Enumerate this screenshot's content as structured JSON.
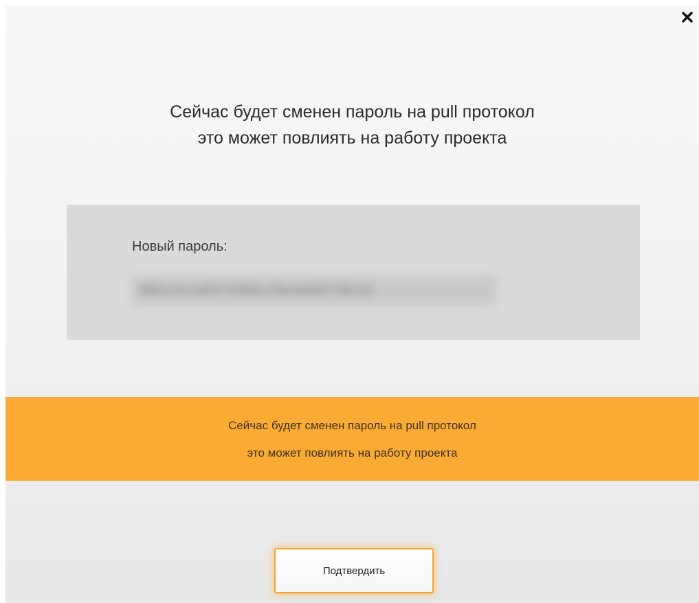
{
  "dialog": {
    "close_icon": "close-icon",
    "title_line1": "Сейчас будет сменен пароль на pull протокол",
    "title_line2": "это может повлиять на работу проекта",
    "password_label": "Новый пароль:",
    "password_value": "9f83c4e1a0b7d2f65c18e4a93b7d0c2e",
    "warning_line1": "Сейчас будет сменен пароль на pull протокол",
    "warning_line2": "это может повлиять на работу проекта",
    "confirm_label": "Подтвердить"
  },
  "colors": {
    "warning_bg": "#fbab34",
    "password_box_bg": "#d9dadc",
    "button_border": "#f2a531"
  }
}
